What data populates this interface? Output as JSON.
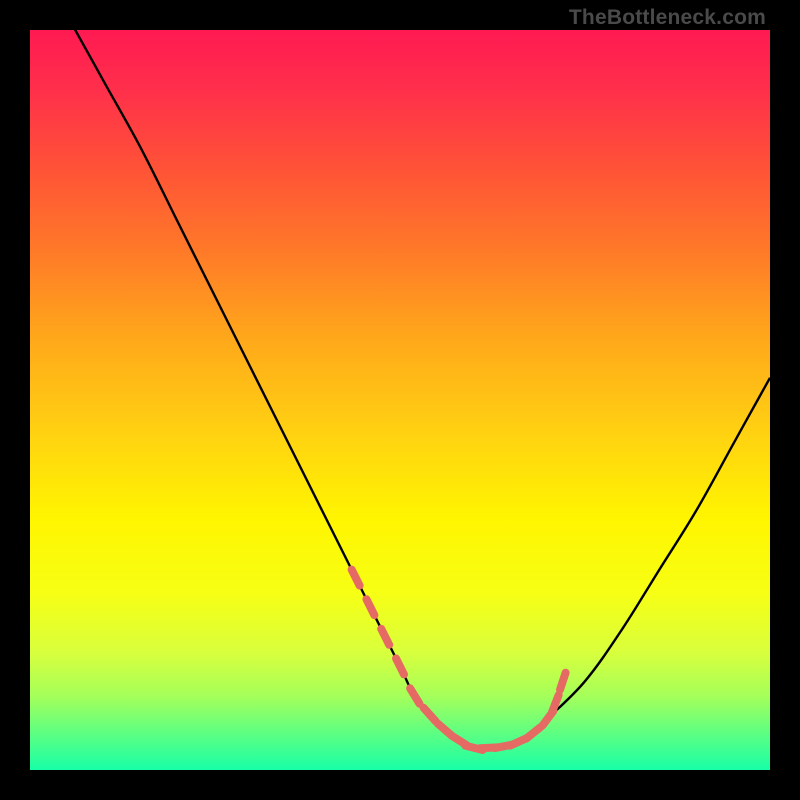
{
  "watermark": "TheBottleneck.com",
  "colors": {
    "background": "#000000",
    "curve": "#000000",
    "marker": "#e66a64",
    "gradient_top": "#ff1a52",
    "gradient_bottom": "#18ffa6"
  },
  "chart_data": {
    "type": "line",
    "title": "",
    "xlabel": "",
    "ylabel": "",
    "xlim": [
      0,
      100
    ],
    "ylim": [
      0,
      100
    ],
    "annotations": [
      "TheBottleneck.com"
    ],
    "series": [
      {
        "name": "bottleneck-curve",
        "x": [
          5,
          10,
          15,
          20,
          25,
          30,
          35,
          40,
          45,
          50,
          52,
          55,
          58,
          60,
          62,
          65,
          68,
          70,
          75,
          80,
          85,
          90,
          95,
          100
        ],
        "y": [
          102,
          93,
          84,
          74,
          64,
          54,
          44,
          34,
          24,
          14,
          10,
          6.5,
          4,
          3,
          3,
          3.5,
          5,
          7,
          12,
          19,
          27,
          35,
          44,
          53
        ]
      },
      {
        "name": "highlight-markers",
        "x": [
          44,
          46,
          48,
          50,
          52,
          54,
          56,
          58,
          60,
          62,
          64,
          66,
          68,
          70,
          71,
          72
        ],
        "y": [
          26,
          22,
          18,
          14,
          10,
          7.5,
          5.5,
          4,
          3,
          3,
          3.2,
          3.8,
          5,
          7,
          9,
          12
        ]
      }
    ]
  }
}
